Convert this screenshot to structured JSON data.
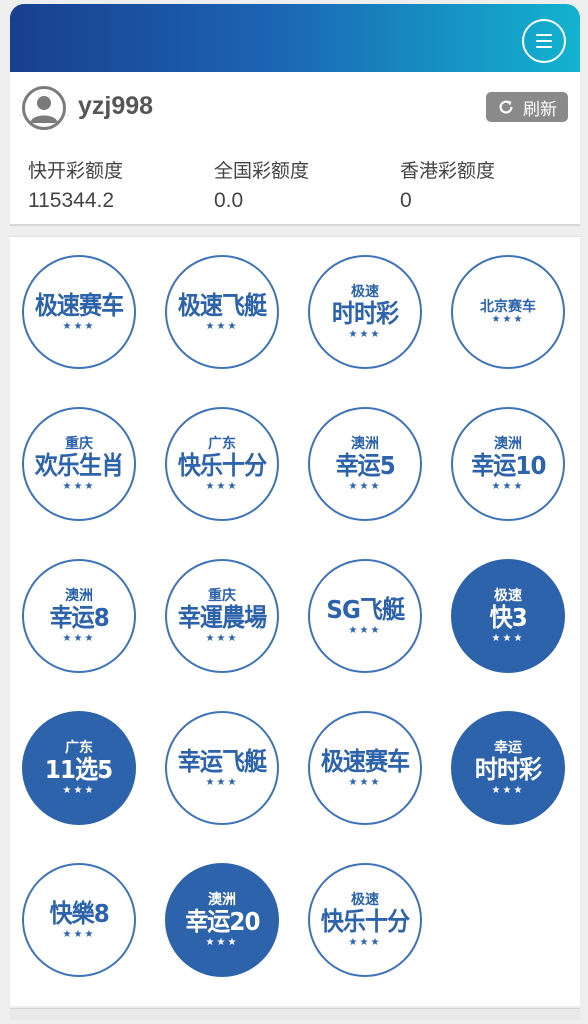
{
  "user": {
    "name": "yzj998",
    "refresh_label": "刷新"
  },
  "quotas": [
    {
      "label": "快开彩额度",
      "value": "115344.2"
    },
    {
      "label": "全国彩额度",
      "value": "0.0"
    },
    {
      "label": "香港彩额度",
      "value": "0"
    }
  ],
  "games": [
    {
      "small": "",
      "big": "极速赛车",
      "filled": false
    },
    {
      "small": "",
      "big": "极速飞艇",
      "filled": false
    },
    {
      "small": "极速",
      "big": "时时彩",
      "filled": false
    },
    {
      "small": "北京赛车",
      "big": "",
      "filled": false
    },
    {
      "small": "重庆",
      "big": "欢乐生肖",
      "filled": false
    },
    {
      "small": "广东",
      "big": "快乐十分",
      "filled": false
    },
    {
      "small": "澳洲",
      "big": "幸运5",
      "filled": false
    },
    {
      "small": "澳洲",
      "big": "幸运10",
      "filled": false
    },
    {
      "small": "澳洲",
      "big": "幸运8",
      "filled": false
    },
    {
      "small": "重庆",
      "big": "幸運農場",
      "filled": false
    },
    {
      "small": "",
      "big": "SG飞艇",
      "filled": false
    },
    {
      "small": "极速",
      "big": "快3",
      "filled": true
    },
    {
      "small": "广东",
      "big": "11选5",
      "filled": true
    },
    {
      "small": "",
      "big": "幸运飞艇",
      "filled": false
    },
    {
      "small": "",
      "big": "极速赛车",
      "filled": false
    },
    {
      "small": "幸运",
      "big": "时时彩",
      "filled": true
    },
    {
      "small": "",
      "big": "快樂8",
      "filled": false
    },
    {
      "small": "澳洲",
      "big": "幸运20",
      "filled": true
    },
    {
      "small": "极速",
      "big": "快乐十分",
      "filled": false
    }
  ],
  "stars": "★★★",
  "colors": {
    "brand_blue": "#2d63ab",
    "header_start": "#1a3f8f",
    "header_end": "#12b3cf"
  }
}
